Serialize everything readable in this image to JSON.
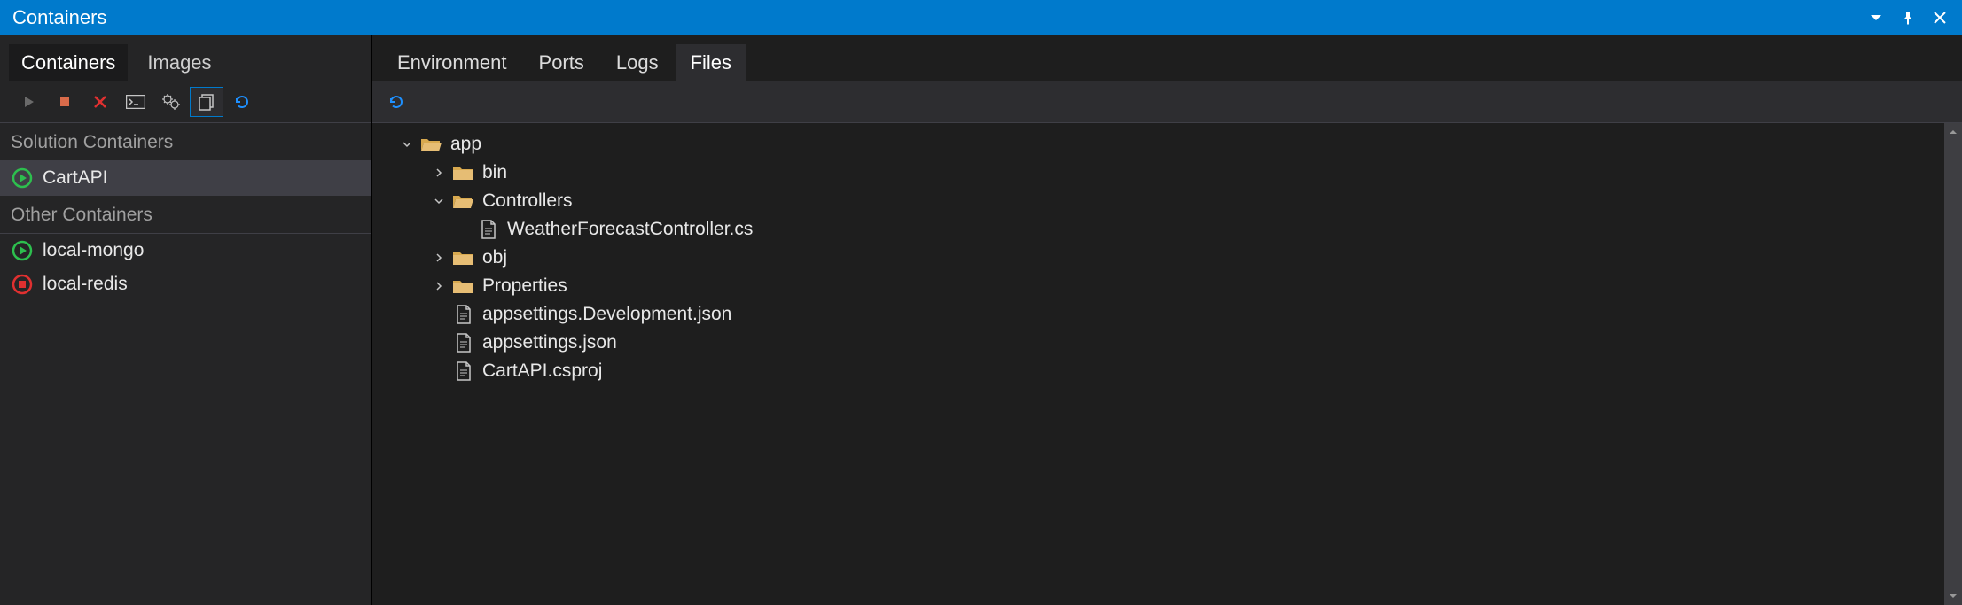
{
  "titlebar": {
    "title": "Containers"
  },
  "left_panel": {
    "tabs": [
      {
        "label": "Containers",
        "active": true
      },
      {
        "label": "Images",
        "active": false
      }
    ],
    "sections": {
      "solution": {
        "header": "Solution Containers",
        "items": [
          {
            "label": "CartAPI",
            "status": "running",
            "selected": true
          }
        ]
      },
      "other": {
        "header": "Other Containers",
        "items": [
          {
            "label": "local-mongo",
            "status": "running",
            "selected": false
          },
          {
            "label": "local-redis",
            "status": "stopped",
            "selected": false
          }
        ]
      }
    }
  },
  "right_panel": {
    "tabs": [
      {
        "label": "Environment",
        "active": false
      },
      {
        "label": "Ports",
        "active": false
      },
      {
        "label": "Logs",
        "active": false
      },
      {
        "label": "Files",
        "active": true
      }
    ],
    "tree": {
      "label": "app",
      "expanded": true,
      "children": [
        {
          "label": "bin",
          "type": "folder",
          "expanded": false
        },
        {
          "label": "Controllers",
          "type": "folder",
          "expanded": true,
          "children": [
            {
              "label": "WeatherForecastController.cs",
              "type": "file"
            }
          ]
        },
        {
          "label": "obj",
          "type": "folder",
          "expanded": false
        },
        {
          "label": "Properties",
          "type": "folder",
          "expanded": false
        },
        {
          "label": "appsettings.Development.json",
          "type": "file"
        },
        {
          "label": "appsettings.json",
          "type": "file"
        },
        {
          "label": "CartAPI.csproj",
          "type": "file"
        }
      ]
    }
  }
}
